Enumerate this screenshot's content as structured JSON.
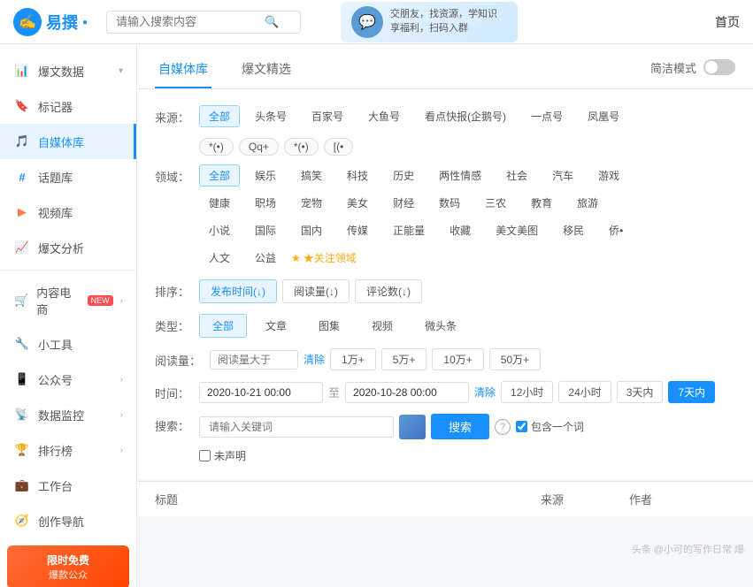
{
  "header": {
    "logo_text": "易撰",
    "logo_icon": "✍",
    "search_placeholder": "请输入搜索内容",
    "banner_line1": "交朋友，找资源，学知识",
    "banner_line2": "享福利，扫码入群",
    "nav_home": "首页"
  },
  "sidebar": {
    "items": [
      {
        "id": "bao-wen-shuju",
        "label": "爆文数据",
        "icon": "📊",
        "has_arrow": true,
        "active": false
      },
      {
        "id": "biao-ji-qi",
        "label": "标记器",
        "icon": "🔖",
        "has_arrow": false,
        "active": false
      },
      {
        "id": "zi-mei-ti-ku",
        "label": "自媒体库",
        "icon": "🎵",
        "has_arrow": false,
        "active": true
      },
      {
        "id": "hua-ti-ku",
        "label": "话题库",
        "icon": "#",
        "has_arrow": false,
        "active": false
      },
      {
        "id": "shi-pin-ku",
        "label": "视频库",
        "icon": "▶",
        "has_arrow": false,
        "active": false
      },
      {
        "id": "bao-wen-fenxi",
        "label": "爆文分析",
        "icon": "📈",
        "has_arrow": false,
        "active": false
      },
      {
        "id": "nei-rong-dianshang",
        "label": "内容电商",
        "icon": "🛒",
        "has_new": true,
        "has_arrow": true,
        "active": false
      },
      {
        "id": "xiao-gong-ju",
        "label": "小工具",
        "icon": "🔧",
        "has_arrow": false,
        "active": false
      },
      {
        "id": "gong-zhong-hao",
        "label": "公众号",
        "icon": "📱",
        "has_arrow": true,
        "active": false
      },
      {
        "id": "shu-ju-jian-kong",
        "label": "数据监控",
        "icon": "📡",
        "has_arrow": true,
        "active": false
      },
      {
        "id": "pai-hang-bang",
        "label": "排行榜",
        "icon": "🏆",
        "has_arrow": true,
        "active": false
      },
      {
        "id": "gong-zuo-tai",
        "label": "工作台",
        "icon": "💼",
        "has_arrow": false,
        "active": false
      },
      {
        "id": "chuang-zuo-dao-hang",
        "label": "创作导航",
        "icon": "🧭",
        "has_arrow": false,
        "active": false
      }
    ],
    "promo_text": "限时免费",
    "promo_sub": "爆款公众"
  },
  "main": {
    "tabs": [
      {
        "id": "zi-mei-ti-ku",
        "label": "自媒体库",
        "active": true
      },
      {
        "id": "bao-wen-jing-xuan",
        "label": "爆文精选",
        "active": false
      },
      {
        "id": "jian-jie-mode",
        "label": "简洁模式",
        "active": false,
        "is_toggle": true
      }
    ],
    "filters": {
      "source_label": "来源：",
      "source_options": [
        {
          "id": "all",
          "label": "全部",
          "active": true
        },
        {
          "id": "tou-tiao",
          "label": "头条号",
          "active": false
        },
        {
          "id": "bai-jia",
          "label": "百家号",
          "active": false
        },
        {
          "id": "da-yu",
          "label": "大鱼号",
          "active": false
        },
        {
          "id": "kan-dian",
          "label": "看点快报(企鹅号)",
          "active": false
        },
        {
          "id": "yi-dian",
          "label": "一点号",
          "active": false
        },
        {
          "id": "feng-huang",
          "label": "凤凰号",
          "active": false
        }
      ],
      "source_tags": [
        {
          "id": "wx",
          "label": "*(•)"
        },
        {
          "id": "qq",
          "label": "Qq+"
        },
        {
          "id": "wb",
          "label": "*(•)"
        },
        {
          "id": "bi",
          "label": "[(•"
        }
      ],
      "domain_label": "领域：",
      "domain_options": [
        {
          "id": "all",
          "label": "全部",
          "active": true
        },
        {
          "id": "yule",
          "label": "娱乐",
          "active": false
        },
        {
          "id": "gaoxiao",
          "label": "搞笑",
          "active": false
        },
        {
          "id": "keji",
          "label": "科技",
          "active": false
        },
        {
          "id": "lishi",
          "label": "历史",
          "active": false
        },
        {
          "id": "liangsex",
          "label": "两性情感",
          "active": false
        },
        {
          "id": "shehui",
          "label": "社会",
          "active": false
        },
        {
          "id": "qiche",
          "label": "汽车",
          "active": false
        },
        {
          "id": "youxi",
          "label": "游戏",
          "active": false
        },
        {
          "id": "jiankang",
          "label": "健康",
          "active": false
        },
        {
          "id": "zhichang",
          "label": "职场",
          "active": false
        },
        {
          "id": "chongwu",
          "label": "宠物",
          "active": false
        },
        {
          "id": "meinv",
          "label": "美女",
          "active": false
        },
        {
          "id": "caijing",
          "label": "财经",
          "active": false
        },
        {
          "id": "shuma",
          "label": "数码",
          "active": false
        },
        {
          "id": "sannong",
          "label": "三农",
          "active": false
        },
        {
          "id": "jiaoyu",
          "label": "教育",
          "active": false
        },
        {
          "id": "lvyou",
          "label": "旅游",
          "active": false
        },
        {
          "id": "xiaoqu",
          "label": "小说",
          "active": false
        },
        {
          "id": "guoji",
          "label": "国际",
          "active": false
        },
        {
          "id": "guonei",
          "label": "国内",
          "active": false
        },
        {
          "id": "chuanmei",
          "label": "传媒",
          "active": false
        },
        {
          "id": "zhengneng",
          "label": "正能量",
          "active": false
        },
        {
          "id": "shoucang",
          "label": "收藏",
          "active": false
        },
        {
          "id": "meiwen",
          "label": "美文美图",
          "active": false
        },
        {
          "id": "yimin",
          "label": "移民",
          "active": false
        },
        {
          "id": "other",
          "label": "侨•",
          "active": false
        }
      ],
      "domain_extra": [
        {
          "id": "renwen",
          "label": "人文",
          "active": false
        },
        {
          "id": "gongyi",
          "label": "公益",
          "active": false
        }
      ],
      "interest_link": "★关注领域",
      "sort_label": "排序：",
      "sort_options": [
        {
          "id": "publish-time",
          "label": "发布时间(↓)",
          "active": true
        },
        {
          "id": "read-count",
          "label": "阅读量(↓)",
          "active": false
        },
        {
          "id": "comment-count",
          "label": "评论数(↓)",
          "active": false
        }
      ],
      "type_label": "类型：",
      "type_options": [
        {
          "id": "all",
          "label": "全部",
          "active": true
        },
        {
          "id": "article",
          "label": "文章",
          "active": false
        },
        {
          "id": "photo",
          "label": "图集",
          "active": false
        },
        {
          "id": "video",
          "label": "视频",
          "active": false
        },
        {
          "id": "weidoutiao",
          "label": "微头条",
          "active": false
        }
      ],
      "read_label": "阅读量：",
      "read_placeholder": "阅读量大于",
      "read_clear": "清除",
      "read_options": [
        "1万+",
        "5万+",
        "10万+",
        "50万+"
      ],
      "time_label": "时间：",
      "time_from": "2020-10-21 00:00",
      "time_to": "2020-10-28 00:00",
      "time_sep": "至",
      "time_clear": "清除",
      "time_options": [
        "12小时",
        "24小时",
        "3天内",
        "7天内"
      ],
      "time_active": "7天内",
      "search_label": "搜索：",
      "search_placeholder": "请输入关键词",
      "search_button": "搜索",
      "help_icon": "?",
      "include_one_label": "包含一个词",
      "no_claim_label": "未声明"
    },
    "table": {
      "col_title": "标题",
      "col_source": "来源",
      "col_author": "作者"
    },
    "watermark": "头条 @小可的写作日常 爆"
  }
}
